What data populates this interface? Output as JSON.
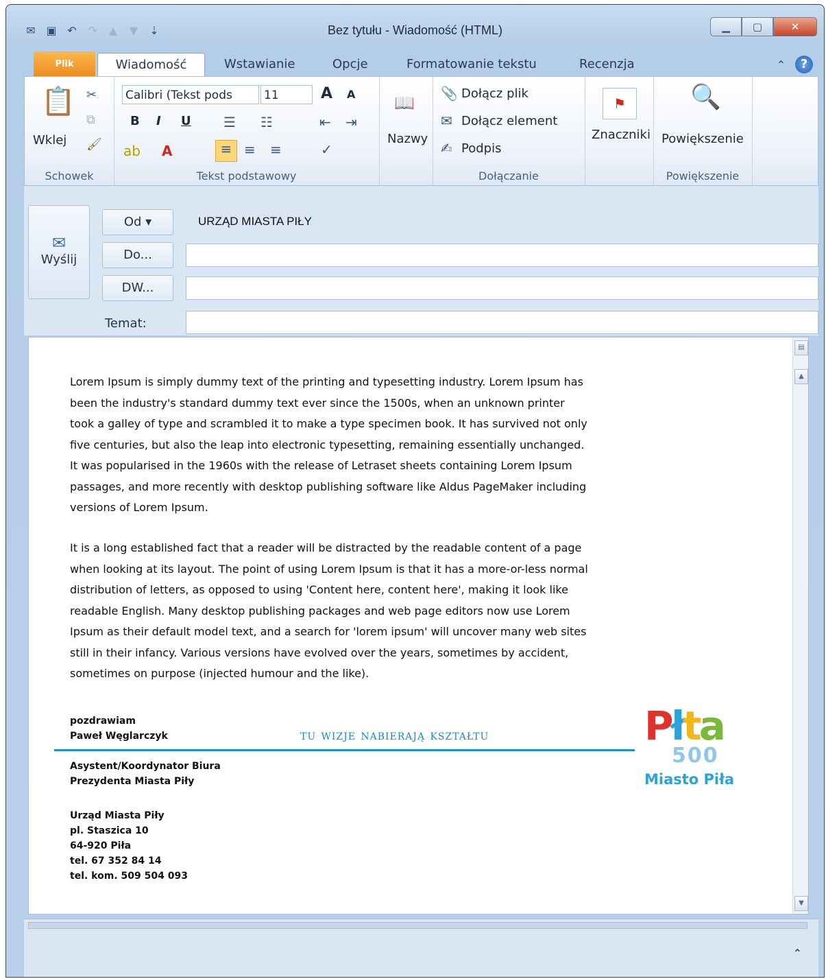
{
  "window": {
    "title": "Bez tytułu - Wiadomość (HTML)"
  },
  "tabs": {
    "file": "Plik",
    "items": [
      "Wiadomość",
      "Wstawianie",
      "Opcje",
      "Formatowanie tekstu",
      "Recenzja"
    ]
  },
  "ribbon": {
    "schowek": {
      "paste": "Wklej",
      "label": "Schowek"
    },
    "tekst": {
      "font": "Calibri (Tekst pods",
      "size": "11",
      "label": "Tekst podstawowy",
      "bold": "B",
      "italic": "I",
      "underline": "U"
    },
    "nazwy": {
      "label": "Nazwy"
    },
    "dolaczanie": {
      "file": "Dołącz plik",
      "element": "Dołącz element",
      "sign": "Podpis",
      "label": "Dołączanie"
    },
    "znaczniki": {
      "label": "Znaczniki"
    },
    "powiekszenie": {
      "btn": "Powiększenie",
      "label": "Powiększenie"
    }
  },
  "header": {
    "send": "Wyślij",
    "from_btn": "Od",
    "from_value": "URZĄD MIASTA PIŁY",
    "to_btn": "Do...",
    "cc_btn": "DW...",
    "subject_label": "Temat:"
  },
  "body": {
    "p1": "Lorem Ipsum is simply dummy text of the printing and typesetting industry. Lorem Ipsum has been the industry's standard dummy text ever since the 1500s, when an unknown printer took a galley of type and scrambled it to make a type specimen book. It has survived not only five centuries, but also the leap into electronic typesetting, remaining essentially unchanged. It was popularised in the 1960s with the release of Letraset sheets containing Lorem Ipsum passages, and more recently with desktop publishing software like Aldus PageMaker including versions of Lorem Ipsum.",
    "p2": "It is a long established fact that a reader will be distracted by the readable content of a page when looking at its layout. The point of using Lorem Ipsum is that it has a more-or-less normal distribution of letters, as opposed to using 'Content here, content here', making it look like readable English. Many desktop publishing packages and web page editors now use Lorem Ipsum as their default model text, and a search for 'lorem ipsum' will uncover many web sites still in their infancy. Various versions have evolved over the years, sometimes by accident, sometimes on purpose (injected humour and the like)."
  },
  "signature": {
    "greeting": "pozdrawiam",
    "name": "Paweł Węglarczyk",
    "slogan": "tu wizje nabierają kształtu",
    "role1": "Asystent/Koordynator Biura",
    "role2": "Prezydenta Miasta Piły",
    "org": "Urząd Miasta Piły",
    "street": "pl. Staszica 10",
    "city": "64-920 Piła",
    "tel": "tel. 67 352 84 14",
    "mobile": "tel. kom. 509 504 093",
    "logo_text": "Miasto Piła",
    "logo_word": "Piła",
    "logo_number": "500"
  },
  "colors": {
    "accent": "#1d8fd5",
    "file_tab": "#ef8a1b"
  }
}
